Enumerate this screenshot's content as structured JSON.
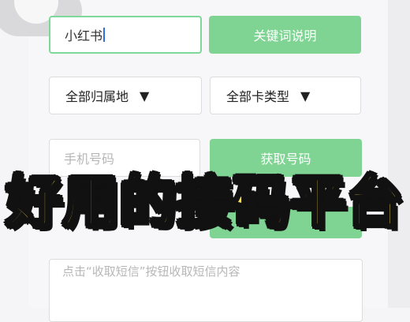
{
  "keyword_input": {
    "value": "小红书"
  },
  "keyword_help_button": "关键词说明",
  "filters": {
    "region": "全部归属地",
    "card_type": "全部卡类型",
    "dropdown_glyph": "▼"
  },
  "phone_input": {
    "placeholder": "手机号码"
  },
  "get_number_button": "获取号码",
  "banner_text": "好用的接码平台",
  "sms_content": {
    "placeholder": "点击“收取短信”按钮收取短信内容"
  }
}
